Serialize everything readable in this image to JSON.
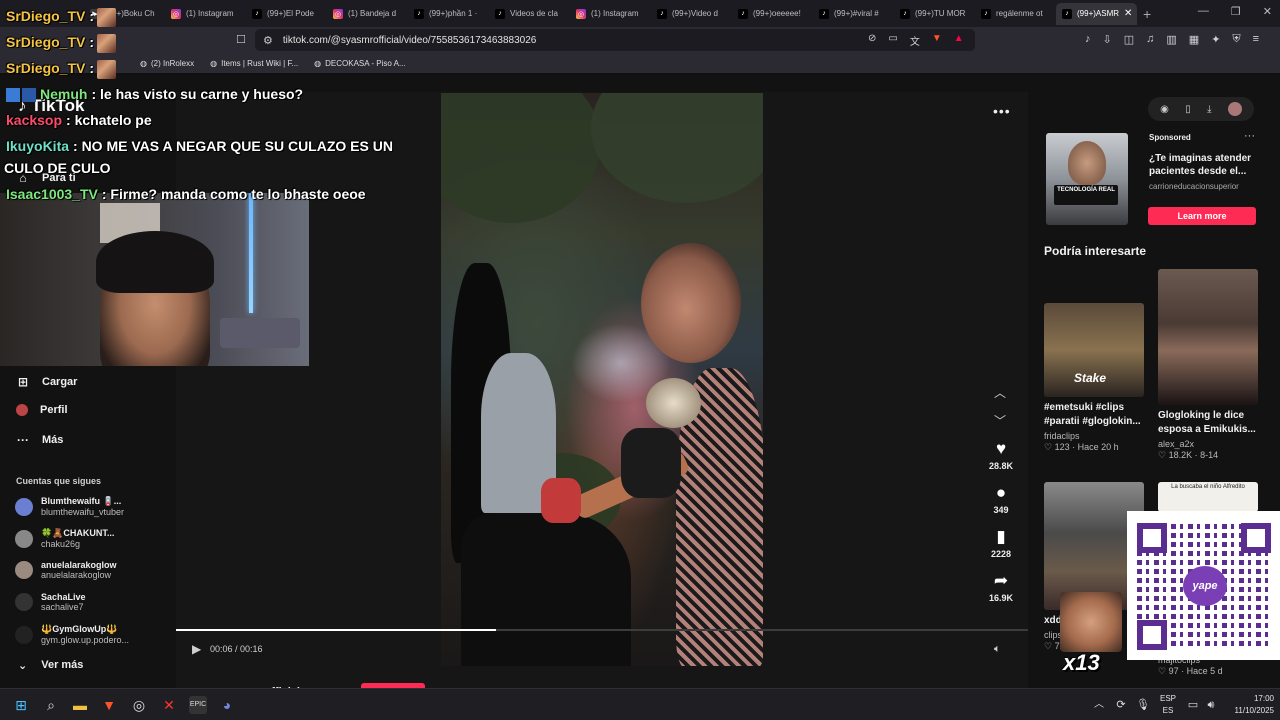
{
  "browser": {
    "tabs": [
      {
        "label": "(99+)Boku Ch",
        "icon": "youtube-icon"
      },
      {
        "label": "(1) Instagram",
        "icon": "instagram-icon"
      },
      {
        "label": "(99+)El Pode",
        "icon": "tiktok-icon"
      },
      {
        "label": "(1) Bandeja d",
        "icon": "instagram-icon"
      },
      {
        "label": "(99+)phần 1 ·",
        "icon": "tiktok-icon"
      },
      {
        "label": "Videos de cla",
        "icon": "tiktok-icon"
      },
      {
        "label": "(1) Instagram",
        "icon": "instagram-icon"
      },
      {
        "label": "(99+)Video d",
        "icon": "tiktok-icon"
      },
      {
        "label": "(99+)oeeeee!",
        "icon": "tiktok-icon"
      },
      {
        "label": "(99+)#viral #",
        "icon": "tiktok-icon"
      },
      {
        "label": "(99+)TU MOR",
        "icon": "tiktok-icon"
      },
      {
        "label": "regálenme ot",
        "icon": "tiktok-icon"
      },
      {
        "label": "(99+)ASMR",
        "icon": "tiktok-icon",
        "active": true
      }
    ],
    "url": "tiktok.com/@syasmrofficial/video/7558536173463883026",
    "bookmarks": [
      {
        "label": "(2) InRolexx",
        "icon": "globe-icon"
      },
      {
        "label": "Items | Rust Wiki | F...",
        "icon": "globe-icon"
      },
      {
        "label": "DECOKASA - Piso A...",
        "icon": "globe-icon"
      }
    ]
  },
  "sidebar": {
    "logo": "TikTok",
    "for_you": "Para ti",
    "nav": [
      {
        "label": "Cargar",
        "icon": "upload-icon"
      },
      {
        "label": "Perfil",
        "icon": "profile-icon"
      },
      {
        "label": "Más",
        "icon": "more-icon"
      }
    ],
    "following_title": "Cuentas que sigues",
    "following": [
      {
        "name": "Blumthewaifu 🪫...",
        "handle": "blumthewaifu_vtuber"
      },
      {
        "name": "🍀🧸CHAKUNT...",
        "handle": "chaku26g"
      },
      {
        "name": "anuelalarakoglow",
        "handle": "anuelalarakoglow"
      },
      {
        "name": "SachaLive",
        "handle": "sachalive7"
      },
      {
        "name": "🔱GymGlowUp🔱",
        "handle": "gym.glow.up.podero..."
      }
    ],
    "see_more": "Ver más"
  },
  "video": {
    "time": "00:06 / 00:16",
    "progress": 0.375,
    "likes": "28.8K",
    "comments": "349",
    "saves": "2228",
    "shares": "16.9K",
    "author": "syasmrofficial"
  },
  "ad": {
    "sponsored": "Sponsored",
    "title": "¿Te imaginas atender pacientes desde el...",
    "account": "carrioneducacionsuperior",
    "cta": "Learn more",
    "thumb_text": "TECNOLOGÍA REAL"
  },
  "suggestions": {
    "title": "Podría interesarte",
    "items": [
      {
        "caption": "#emetsuki #clips #paratii #gloglokin...",
        "author": "fridaclips",
        "likes": "123",
        "time": "Hace 20 h",
        "badge": "Stake"
      },
      {
        "caption": "Glogloking le dice esposa a Emikukis...",
        "author": "alex_a2x",
        "likes": "18.2K",
        "time": "8-14"
      },
      {
        "caption": "xdd #st...",
        "author": "clips",
        "likes": "72",
        "time": ""
      },
      {
        "caption": "La buscaba el niño Alfredito",
        "author": "majitoclips",
        "likes": "97",
        "time": "Hace 5 d"
      }
    ]
  },
  "stream_overlay": {
    "chat": [
      {
        "user": "SrDiego_TV",
        "color": "#f5c542",
        "text": ":"
      },
      {
        "user": "SrDiego_TV",
        "color": "#f5c542",
        "text": ":"
      },
      {
        "user": "SrDiego_TV",
        "color": "#f5c542",
        "text": ":"
      },
      {
        "user": "Nemuh",
        "color": "#7de87d",
        "text": ": le has visto su carne y hueso?"
      },
      {
        "user": "kacksop",
        "color": "#ff4a6b",
        "text": ": kchatelo pe"
      },
      {
        "user": "IkuyoKita",
        "color": "#6ee0c6",
        "text": ": NO ME VAS A NEGAR QUE SU CULAZO ES UN"
      },
      {
        "user": "",
        "color": "#ffffff",
        "text": "CULO DE CULO"
      },
      {
        "user": "Isaac1003_TV",
        "color": "#7de87d",
        "text": ": Firme? manda como te lo bhaste oeoe"
      }
    ],
    "qr_brand": "yape",
    "multiplier": "x13"
  },
  "taskbar": {
    "language": "ESP",
    "region": "ES",
    "time": "17:00",
    "date": "11/10/2025"
  },
  "colors": {
    "tiktok_red": "#fe2c55",
    "yape_purple": "#5c2d91"
  }
}
